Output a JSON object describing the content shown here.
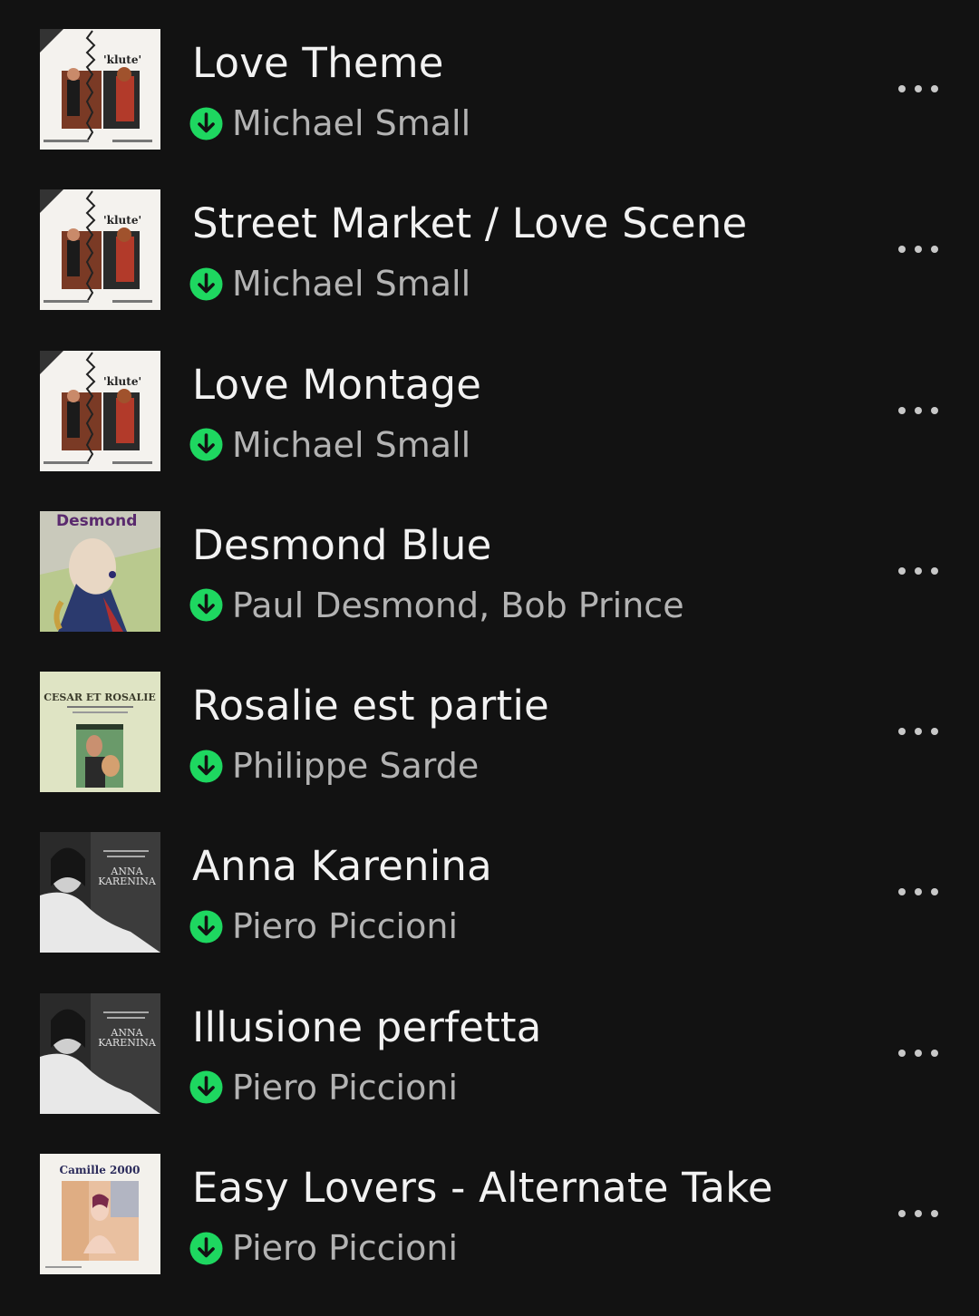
{
  "tracks": [
    {
      "title": "Love Theme",
      "artist": "Michael Small",
      "downloaded": true,
      "cover": "klute"
    },
    {
      "title": "Street Market / Love Scene",
      "artist": "Michael Small",
      "downloaded": true,
      "cover": "klute"
    },
    {
      "title": "Love Montage",
      "artist": "Michael Small",
      "downloaded": true,
      "cover": "klute"
    },
    {
      "title": "Desmond Blue",
      "artist": "Paul Desmond, Bob Prince",
      "downloaded": true,
      "cover": "desmond"
    },
    {
      "title": "Rosalie est partie",
      "artist": "Philippe Sarde",
      "downloaded": true,
      "cover": "cesar"
    },
    {
      "title": "Anna Karenina",
      "artist": "Piero Piccioni",
      "downloaded": true,
      "cover": "karenina"
    },
    {
      "title": "Illusione perfetta",
      "artist": "Piero Piccioni",
      "downloaded": true,
      "cover": "karenina"
    },
    {
      "title": "Easy Lovers - Alternate Take",
      "artist": "Piero Piccioni",
      "downloaded": true,
      "cover": "camille"
    }
  ],
  "covers": {
    "klute": {
      "text": "'klute'"
    },
    "desmond": {
      "text": "Desmond"
    },
    "cesar": {
      "text": "CESAR ET ROSALIE"
    },
    "karenina": {
      "text_line1": "ANNA",
      "text_line2": "KARENINA"
    },
    "camille": {
      "text": "Camille 2000"
    }
  },
  "colors": {
    "background": "#121212",
    "title": "#f2f2f2",
    "artist": "#b3b3b3",
    "download_accent": "#1ed760",
    "more_dots": "#c8c8c8"
  },
  "icons": {
    "download": "download-arrow-circle-icon",
    "more": "more-horizontal-icon"
  }
}
